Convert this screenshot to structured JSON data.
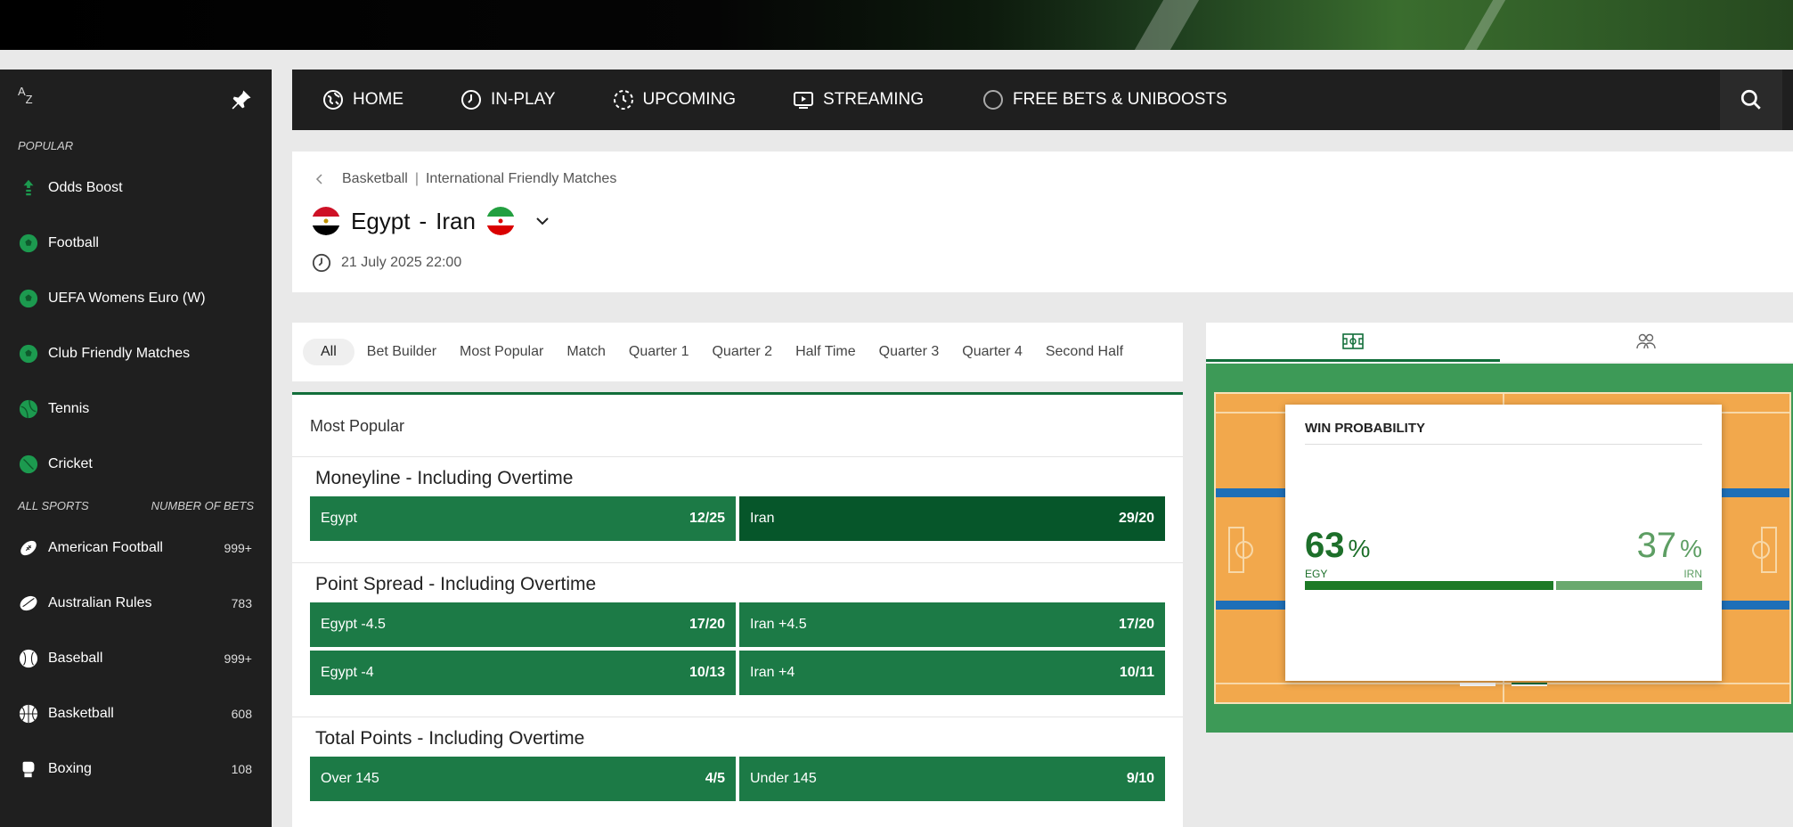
{
  "sidebar": {
    "popular_heading": "POPULAR",
    "popular": [
      {
        "label": "Odds Boost",
        "icon": "odds-boost-icon"
      },
      {
        "label": "Football",
        "icon": "football-icon"
      },
      {
        "label": "UEFA Womens Euro (W)",
        "icon": "football-icon"
      },
      {
        "label": "Club Friendly Matches",
        "icon": "football-icon"
      },
      {
        "label": "Tennis",
        "icon": "tennis-icon"
      },
      {
        "label": "Cricket",
        "icon": "cricket-icon"
      }
    ],
    "all_sports_heading": "ALL SPORTS",
    "number_of_bets_heading": "NUMBER OF BETS",
    "sports": [
      {
        "label": "American Football",
        "count": "999+",
        "icon": "american-football-icon"
      },
      {
        "label": "Australian Rules",
        "count": "783",
        "icon": "australian-rules-icon"
      },
      {
        "label": "Baseball",
        "count": "999+",
        "icon": "baseball-icon"
      },
      {
        "label": "Basketball",
        "count": "608",
        "icon": "basketball-icon"
      },
      {
        "label": "Boxing",
        "count": "108",
        "icon": "boxing-icon"
      }
    ]
  },
  "nav": {
    "home": "HOME",
    "inplay": "IN-PLAY",
    "upcoming": "UPCOMING",
    "streaming": "STREAMING",
    "freebets": "FREE BETS & UNIBOOSTS"
  },
  "event": {
    "sport": "Basketball",
    "competition": "International Friendly Matches",
    "home_team": "Egypt",
    "away_team": "Iran",
    "separator": "-",
    "datetime": "21 July 2025 22:00"
  },
  "tabs": [
    "All",
    "Bet Builder",
    "Most Popular",
    "Match",
    "Quarter 1",
    "Quarter 2",
    "Half Time",
    "Quarter 3",
    "Quarter 4",
    "Second Half"
  ],
  "markets": {
    "section_title": "Most Popular",
    "moneyline": {
      "title": "Moneyline - Including Overtime",
      "home": {
        "label": "Egypt",
        "price": "12/25"
      },
      "away": {
        "label": "Iran",
        "price": "29/20"
      }
    },
    "spread": {
      "title": "Point Spread - Including Overtime",
      "rows": [
        {
          "home_label": "Egypt  -4.5",
          "home_price": "17/20",
          "away_label": "Iran  +4.5",
          "away_price": "17/20"
        },
        {
          "home_label": "Egypt  -4",
          "home_price": "10/13",
          "away_label": "Iran  +4",
          "away_price": "10/11"
        }
      ]
    },
    "totals": {
      "title": "Total Points - Including Overtime",
      "rows": [
        {
          "home_label": "Over  145",
          "home_price": "4/5",
          "away_label": "Under  145",
          "away_price": "9/10"
        }
      ]
    }
  },
  "win_probability": {
    "title": "WIN PROBABILITY",
    "home_value": "63",
    "away_value": "37",
    "pct_sign": "%",
    "home_abbr": "EGY",
    "away_abbr": "IRN",
    "home_fraction": 0.63,
    "away_fraction": 0.37
  },
  "colors": {
    "odds_green": "#1c7a46",
    "odds_dark_green": "#06562a",
    "sidebar_bg": "#1f1f1f",
    "court_orange": "#f2a84c",
    "court_surround": "#3d9a57"
  }
}
